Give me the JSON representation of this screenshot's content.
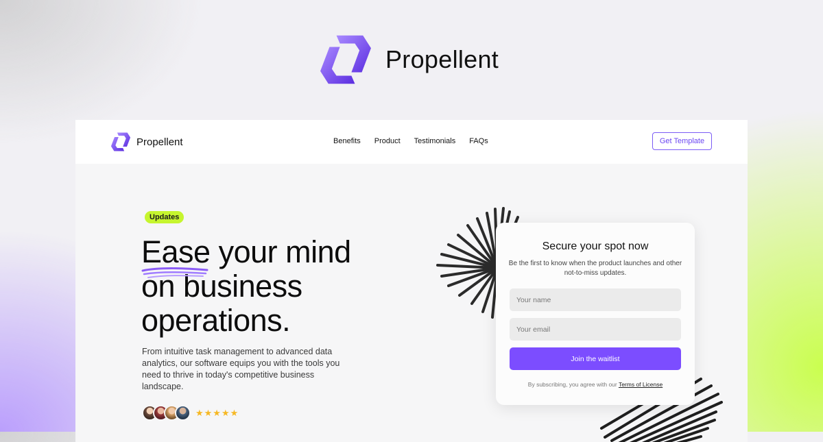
{
  "hero": {
    "brand_name": "Propellent",
    "logo_icon": "propellent-logo-icon"
  },
  "nav": {
    "brand_name": "Propellent",
    "links": [
      {
        "label": "Benefits"
      },
      {
        "label": "Product"
      },
      {
        "label": "Testimonials"
      },
      {
        "label": "FAQs"
      }
    ],
    "cta_label": "Get Template"
  },
  "main": {
    "badge": "Updates",
    "headline_lines": [
      "Ease your mind",
      "on business",
      "operations."
    ],
    "subtext": "From intuitive task management to advanced data analytics, our software equips you with the tools you need to thrive in today's competitive business landscape.",
    "rating_stars": 5,
    "stars_text": "★★★★★",
    "avatar_count": 4
  },
  "form": {
    "title": "Secure your spot now",
    "description": "Be the first to know when the product launches and other not-to-miss updates.",
    "name_placeholder": "Your name",
    "email_placeholder": "Your email",
    "submit_label": "Join the waitlist",
    "terms_prefix": "By subscribing, you agree with our ",
    "terms_link": "Terms of License"
  },
  "colors": {
    "accent": "#7c4dff",
    "badge": "#c6f52f",
    "star": "#f6b824",
    "logo_light": "#a07cff",
    "logo_dark": "#5b2de0"
  }
}
